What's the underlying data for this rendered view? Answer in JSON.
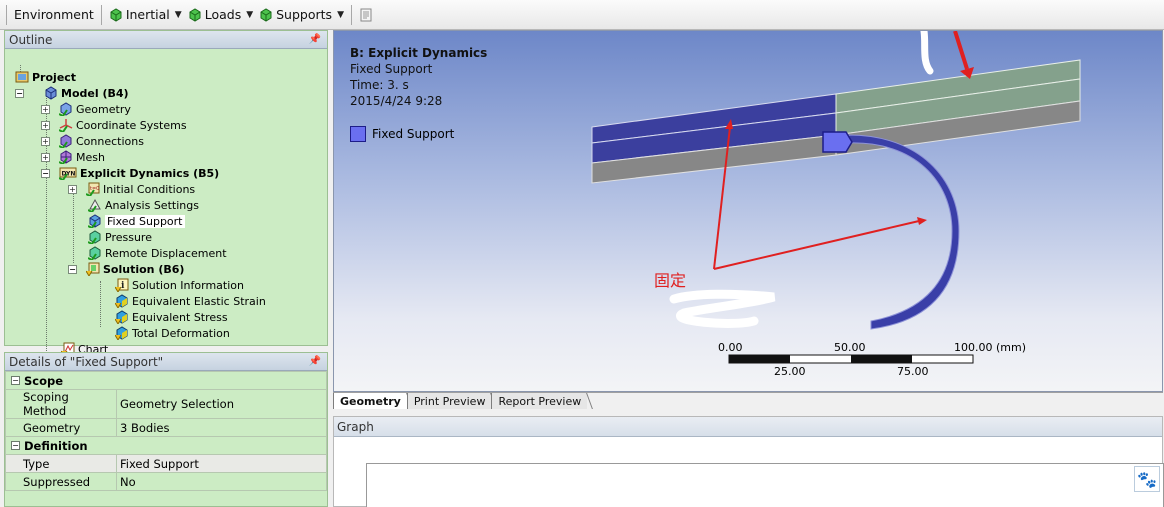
{
  "toolbar": {
    "environment": "Environment",
    "inertial": "Inertial",
    "loads": "Loads",
    "supports": "Supports"
  },
  "outline": {
    "title": "Outline",
    "items": [
      {
        "label": "Project",
        "icon": "project-icon"
      },
      {
        "label": "Model (B4)",
        "icon": "model-icon"
      },
      {
        "label": "Geometry",
        "icon": "geometry-icon"
      },
      {
        "label": "Coordinate Systems",
        "icon": "coordinate-systems-icon"
      },
      {
        "label": "Connections",
        "icon": "connections-icon"
      },
      {
        "label": "Mesh",
        "icon": "mesh-icon"
      },
      {
        "label": "Explicit Dynamics (B5)",
        "icon": "explicit-dynamics-icon",
        "badge": "DYN"
      },
      {
        "label": "Initial Conditions",
        "icon": "initial-conditions-icon"
      },
      {
        "label": "Analysis Settings",
        "icon": "analysis-settings-icon"
      },
      {
        "label": "Fixed Support",
        "icon": "fixed-support-icon"
      },
      {
        "label": "Pressure",
        "icon": "pressure-icon"
      },
      {
        "label": "Remote Displacement",
        "icon": "remote-displacement-icon"
      },
      {
        "label": "Solution (B6)",
        "icon": "solution-icon"
      },
      {
        "label": "Solution Information",
        "icon": "solution-information-icon"
      },
      {
        "label": "Equivalent Elastic Strain",
        "icon": "equivalent-elastic-strain-icon"
      },
      {
        "label": "Equivalent Stress",
        "icon": "equivalent-stress-icon"
      },
      {
        "label": "Total Deformation",
        "icon": "total-deformation-icon"
      },
      {
        "label": "Chart",
        "icon": "chart-icon"
      }
    ]
  },
  "details": {
    "title": "Details of \"Fixed Support\"",
    "groups": [
      {
        "name": "Scope",
        "rows": [
          {
            "key": "Scoping Method",
            "value": "Geometry Selection"
          },
          {
            "key": "Geometry",
            "value": "3 Bodies"
          }
        ]
      },
      {
        "name": "Definition",
        "rows": [
          {
            "key": "Type",
            "value": "Fixed Support"
          },
          {
            "key": "Suppressed",
            "value": "No"
          }
        ]
      }
    ]
  },
  "viewport": {
    "title": "B: Explicit Dynamics",
    "subtitle": "Fixed Support",
    "time": "Time: 3. s",
    "date": "2015/4/24 9:28",
    "legend_label": "Fixed Support",
    "annotation": "固定",
    "scale": {
      "top_labels": [
        "0.00",
        "50.00",
        "100.00 (mm)"
      ],
      "bottom_labels": [
        "25.00",
        "75.00"
      ]
    }
  },
  "tabs": [
    "Geometry",
    "Print Preview",
    "Report Preview"
  ],
  "graph": {
    "title": "Graph"
  },
  "colors": {
    "tree_background": "#ccecc4",
    "selection_blue": "#3b3f9e",
    "fixed_support_marker": "#6a6ff0",
    "annotation_red": "#e02020"
  }
}
